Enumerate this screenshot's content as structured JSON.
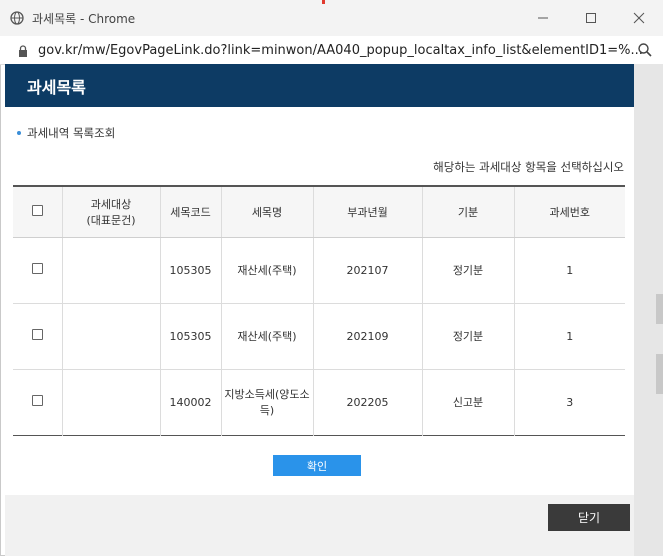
{
  "window": {
    "title": "과세목록 - Chrome",
    "url": "gov.kr/mw/EgovPageLink.do?link=minwon/AA040_popup_localtax_info_list&elementID1=%..."
  },
  "popup": {
    "header": "과세목록",
    "section_title": "과세내역 목록조회",
    "guide_text": "해당하는 과세대상 항목을 선택하십시오"
  },
  "table": {
    "headers": {
      "target_line1": "과세대상",
      "target_line2": "(대표문건)",
      "tax_code": "세목코드",
      "tax_name": "세목명",
      "levy_ym": "부과년월",
      "period": "기분",
      "tax_no": "과세번호"
    },
    "rows": [
      {
        "target": "",
        "tax_code": "105305",
        "tax_name": "재산세(주택)",
        "levy_ym": "202107",
        "period": "정기분",
        "tax_no": "1"
      },
      {
        "target": "",
        "tax_code": "105305",
        "tax_name": "재산세(주택)",
        "levy_ym": "202109",
        "period": "정기분",
        "tax_no": "1"
      },
      {
        "target": "",
        "tax_code": "140002",
        "tax_name": "지방소득세(양도소득)",
        "levy_ym": "202205",
        "period": "신고분",
        "tax_no": "3"
      }
    ]
  },
  "buttons": {
    "confirm": "확인",
    "close": "닫기"
  },
  "icons": {
    "page": "globe-icon",
    "lock": "lock-icon",
    "zoom": "search-icon",
    "minimize": "minimize-icon",
    "maximize": "maximize-icon",
    "close": "close-icon"
  },
  "colors": {
    "header_bg": "#0d3b64",
    "confirm_bg": "#2a93ea",
    "close_bg": "#3a3a3a"
  }
}
